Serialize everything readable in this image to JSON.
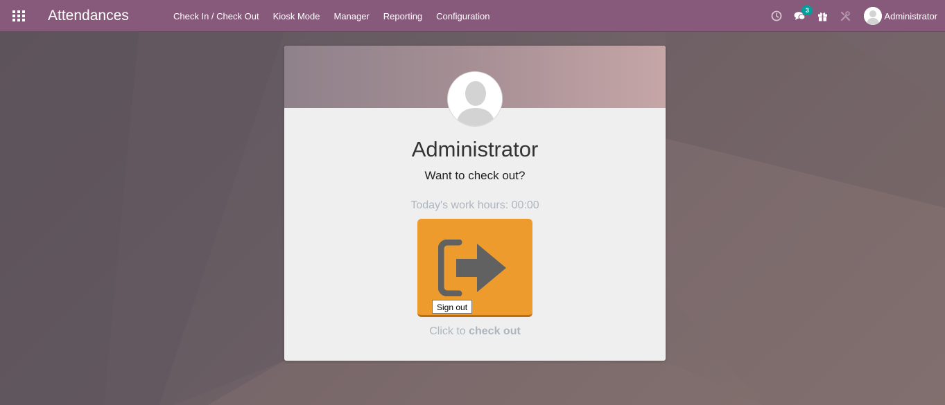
{
  "navbar": {
    "app_title": "Attendances",
    "menu": [
      {
        "label": "Check In / Check Out"
      },
      {
        "label": "Kiosk Mode"
      },
      {
        "label": "Manager"
      },
      {
        "label": "Reporting"
      },
      {
        "label": "Configuration"
      }
    ],
    "systray": {
      "messages_count": "3",
      "user_name": "Administrator"
    },
    "icons": [
      "apps-grid-icon",
      "clock-icon",
      "chat-icon",
      "gift-icon",
      "tools-icon",
      "user-avatar"
    ]
  },
  "card": {
    "employee_name": "Administrator",
    "question": "Want to check out?",
    "work_hours_label": "Today's work hours: 00:00",
    "button_icon": "sign-out-icon",
    "tooltip": "Sign out",
    "hint_prefix": "Click to",
    "hint_action": "check out"
  },
  "colors": {
    "navbar": "#875a7b",
    "badge": "#00a09d",
    "checkout_button": "#ee9b2e",
    "muted_text": "#adb5bd"
  }
}
